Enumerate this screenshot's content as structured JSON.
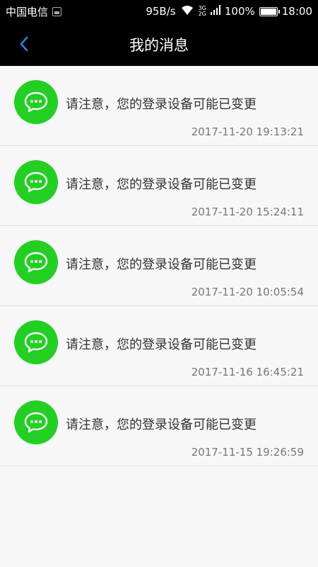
{
  "status_bar": {
    "carrier": "中国电信",
    "speed": "95B/s",
    "net_top": "3G",
    "net_bottom": "2G",
    "battery": "100%",
    "time": "18:00"
  },
  "header": {
    "title": "我的消息",
    "back_icon": "chevron-left-icon"
  },
  "colors": {
    "accent_blue": "#1e88e5",
    "avatar_green": "#22d022"
  },
  "messages": [
    {
      "text": "请注意，您的登录设备可能已变更",
      "time": "2017-11-20 19:13:21"
    },
    {
      "text": "请注意，您的登录设备可能已变更",
      "time": "2017-11-20 15:24:11"
    },
    {
      "text": "请注意，您的登录设备可能已变更",
      "time": "2017-11-20 10:05:54"
    },
    {
      "text": "请注意，您的登录设备可能已变更",
      "time": "2017-11-16 16:45:21"
    },
    {
      "text": "请注意，您的登录设备可能已变更",
      "time": "2017-11-15 19:26:59"
    }
  ]
}
